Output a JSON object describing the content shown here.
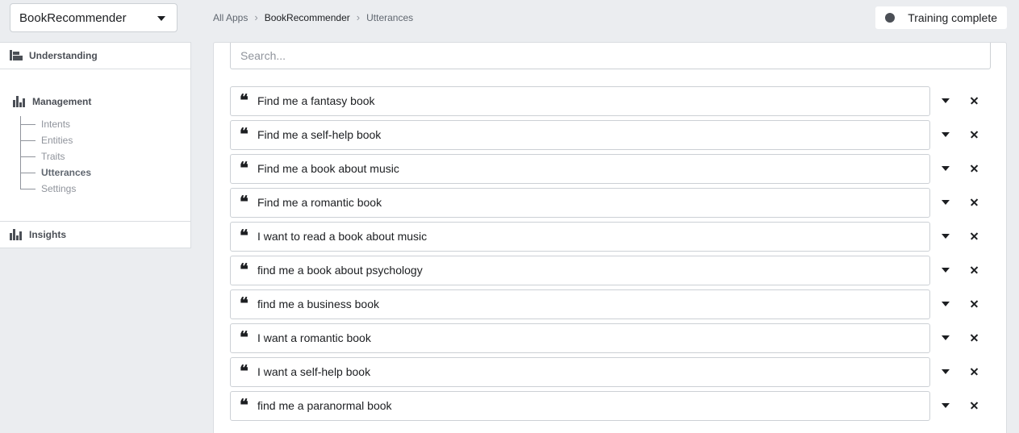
{
  "app_selector": {
    "value": "BookRecommender"
  },
  "nav": {
    "understanding": "Understanding",
    "management": "Management",
    "management_items": [
      {
        "label": "Intents"
      },
      {
        "label": "Entities"
      },
      {
        "label": "Traits"
      },
      {
        "label": "Utterances",
        "active": true
      },
      {
        "label": "Settings"
      }
    ],
    "insights": "Insights"
  },
  "breadcrumb": {
    "root": "All Apps",
    "app": "BookRecommender",
    "page": "Utterances"
  },
  "status": {
    "label": "Training complete"
  },
  "search": {
    "placeholder": "Search..."
  },
  "utterances": [
    "Find me a fantasy book",
    "Find me a self-help book",
    "Find me a book about music",
    "Find me a romantic book",
    "I want to read a book about music",
    "find me a book about psychology",
    "find me a business book",
    "I want a romantic book",
    "I want a self-help book",
    "find me a paranormal book"
  ]
}
